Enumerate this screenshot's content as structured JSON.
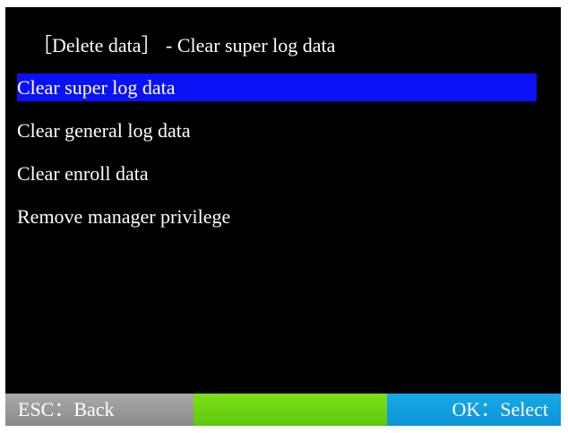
{
  "header": {
    "title": "［Delete data］ - Clear super log data"
  },
  "menu": {
    "items": [
      {
        "label": "Clear super log data",
        "selected": true
      },
      {
        "label": "Clear general log data",
        "selected": false
      },
      {
        "label": "Clear enroll data",
        "selected": false
      },
      {
        "label": "Remove manager privilege",
        "selected": false
      }
    ]
  },
  "statusbar": {
    "left_label": "ESC：Back",
    "right_label": "OK：Select"
  },
  "colors": {
    "background": "#000000",
    "selection": "#0a12f5",
    "status_left": "#999999",
    "status_mid": "#6cd414",
    "status_right": "#12a0df"
  }
}
